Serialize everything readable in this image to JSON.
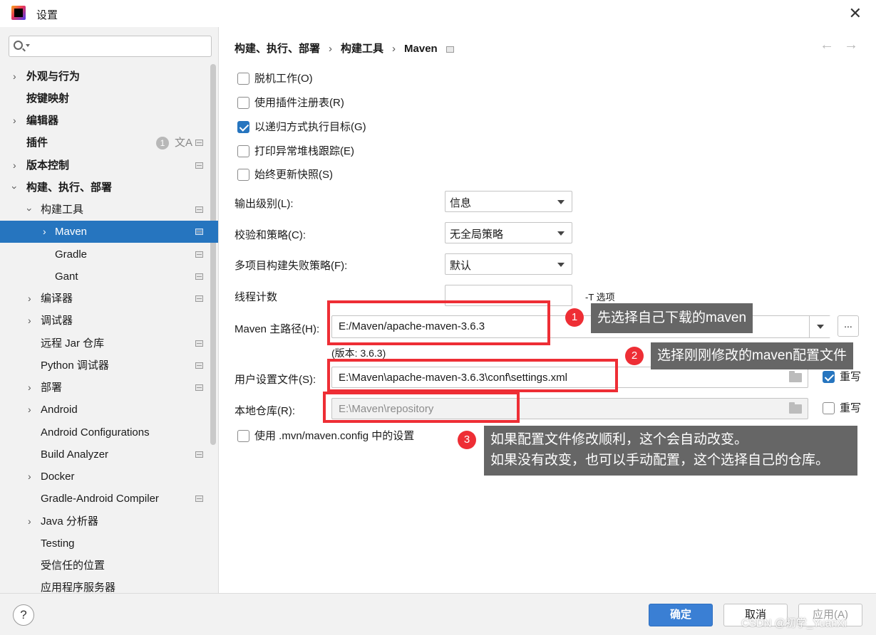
{
  "window": {
    "title": "设置"
  },
  "sidebar": {
    "items": [
      {
        "label": "外观与行为",
        "bold": true
      },
      {
        "label": "按键映射",
        "bold": true
      },
      {
        "label": "编辑器",
        "bold": true
      },
      {
        "label": "插件",
        "bold": true,
        "badge": "1"
      },
      {
        "label": "版本控制",
        "bold": true
      },
      {
        "label": "构建、执行、部署",
        "bold": true
      },
      {
        "label": "构建工具"
      },
      {
        "label": "Maven"
      },
      {
        "label": "Gradle"
      },
      {
        "label": "Gant"
      },
      {
        "label": "编译器"
      },
      {
        "label": "调试器"
      },
      {
        "label": "远程 Jar 仓库"
      },
      {
        "label": "Python 调试器"
      },
      {
        "label": "部署"
      },
      {
        "label": "Android"
      },
      {
        "label": "Android Configurations"
      },
      {
        "label": "Build Analyzer"
      },
      {
        "label": "Docker"
      },
      {
        "label": "Gradle-Android Compiler"
      },
      {
        "label": "Java 分析器"
      },
      {
        "label": "Testing"
      },
      {
        "label": "受信任的位置"
      },
      {
        "label": "应用程序服务器"
      }
    ]
  },
  "breadcrumb": {
    "part1": "构建、执行、部署",
    "part2": "构建工具",
    "part3": "Maven"
  },
  "options": {
    "offline": {
      "label": "脱机工作(O)",
      "checked": false
    },
    "plugin_registry": {
      "label": "使用插件注册表(R)",
      "checked": false
    },
    "recursive": {
      "label": "以递归方式执行目标(G)",
      "checked": true
    },
    "print_stack": {
      "label": "打印异常堆栈跟踪(E)",
      "checked": false
    },
    "always_update": {
      "label": "始终更新快照(S)",
      "checked": false
    },
    "use_mvn_config": {
      "label": "使用 .mvn/maven.config 中的设置",
      "checked": false
    }
  },
  "fields": {
    "output_level": {
      "label": "输出级别(L):",
      "value": "信息"
    },
    "checksum_policy": {
      "label": "校验和策略(C):",
      "value": "无全局策略"
    },
    "failure_policy": {
      "label": "多项目构建失败策略(F):",
      "value": "默认"
    },
    "thread_count": {
      "label": "线程计数",
      "value": "",
      "suffix": "-T 选项"
    },
    "maven_home": {
      "label": "Maven 主路径(H):",
      "value": "E:/Maven/apache-maven-3.6.3",
      "version": "(版本: 3.6.3)",
      "browse": "..."
    },
    "user_settings": {
      "label": "用户设置文件(S):",
      "value": "E:\\Maven\\apache-maven-3.6.3\\conf\\settings.xml",
      "override_label": "重写",
      "override": true
    },
    "local_repo": {
      "label": "本地仓库(R):",
      "value": "E:\\Maven\\repository",
      "override_label": "重写",
      "override": false
    }
  },
  "annotations": [
    {
      "number": "1",
      "text": "先选择自己下载的maven"
    },
    {
      "number": "2",
      "text": "选择刚刚修改的maven配置文件"
    },
    {
      "number": "3",
      "line1": "如果配置文件修改顺利，这个会自动改变。",
      "line2": "如果没有改变，也可以手动配置，这个选择自己的仓库。"
    }
  ],
  "footer": {
    "help": "?",
    "ok": "确定",
    "cancel": "取消",
    "apply": "应用(A)",
    "watermark": "CSDN @初学_YuanXi"
  },
  "colors": {
    "accent": "#2675bf",
    "annotation_red": "#ee2e35",
    "callout_bg": "#666666"
  }
}
